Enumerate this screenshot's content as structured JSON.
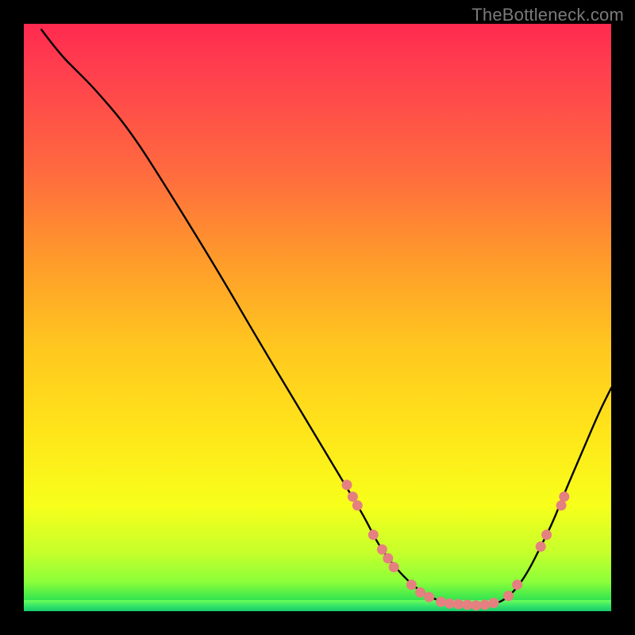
{
  "attribution": "TheBottleneck.com",
  "chart_data": {
    "type": "line",
    "title": "",
    "xlabel": "",
    "ylabel": "",
    "x_range": [
      0,
      100
    ],
    "y_range": [
      0,
      100
    ],
    "curve": [
      {
        "x": 3,
        "y": 99
      },
      {
        "x": 6,
        "y": 95
      },
      {
        "x": 9,
        "y": 92
      },
      {
        "x": 12,
        "y": 89
      },
      {
        "x": 18,
        "y": 82
      },
      {
        "x": 25,
        "y": 71
      },
      {
        "x": 33,
        "y": 58
      },
      {
        "x": 40,
        "y": 46
      },
      {
        "x": 46,
        "y": 36
      },
      {
        "x": 52,
        "y": 26
      },
      {
        "x": 55,
        "y": 21
      },
      {
        "x": 58,
        "y": 16
      },
      {
        "x": 60,
        "y": 12
      },
      {
        "x": 62,
        "y": 9
      },
      {
        "x": 65,
        "y": 5.5
      },
      {
        "x": 68,
        "y": 3
      },
      {
        "x": 71,
        "y": 1.6
      },
      {
        "x": 74,
        "y": 1.2
      },
      {
        "x": 77,
        "y": 1.0
      },
      {
        "x": 80,
        "y": 1.2
      },
      {
        "x": 82,
        "y": 2
      },
      {
        "x": 84,
        "y": 4
      },
      {
        "x": 86,
        "y": 7
      },
      {
        "x": 88,
        "y": 11
      },
      {
        "x": 90,
        "y": 15
      },
      {
        "x": 92,
        "y": 20
      },
      {
        "x": 95,
        "y": 27
      },
      {
        "x": 98,
        "y": 34
      },
      {
        "x": 100,
        "y": 38
      }
    ],
    "markers": [
      {
        "x": 55.0,
        "y": 21.5
      },
      {
        "x": 56.0,
        "y": 19.5
      },
      {
        "x": 56.8,
        "y": 18.0
      },
      {
        "x": 59.5,
        "y": 13.0
      },
      {
        "x": 61.0,
        "y": 10.5
      },
      {
        "x": 62.0,
        "y": 9.0
      },
      {
        "x": 63.0,
        "y": 7.5
      },
      {
        "x": 66.0,
        "y": 4.5
      },
      {
        "x": 67.5,
        "y": 3.2
      },
      {
        "x": 69.0,
        "y": 2.4
      },
      {
        "x": 71.0,
        "y": 1.6
      },
      {
        "x": 72.5,
        "y": 1.3
      },
      {
        "x": 74.0,
        "y": 1.2
      },
      {
        "x": 75.5,
        "y": 1.1
      },
      {
        "x": 77.0,
        "y": 1.0
      },
      {
        "x": 78.5,
        "y": 1.1
      },
      {
        "x": 80.0,
        "y": 1.4
      },
      {
        "x": 82.5,
        "y": 2.6
      },
      {
        "x": 84.0,
        "y": 4.5
      },
      {
        "x": 88.0,
        "y": 11.0
      },
      {
        "x": 89.0,
        "y": 13.0
      },
      {
        "x": 91.5,
        "y": 18.0
      },
      {
        "x": 92.0,
        "y": 19.5
      }
    ],
    "gradient_colors": {
      "top": "#ff2a4f",
      "mid_upper": "#ff9a2b",
      "mid": "#ffe61a",
      "mid_lower": "#c6ff2b",
      "bottom": "#19c96a"
    },
    "marker_color": "#e58080",
    "curve_color": "#000000"
  }
}
